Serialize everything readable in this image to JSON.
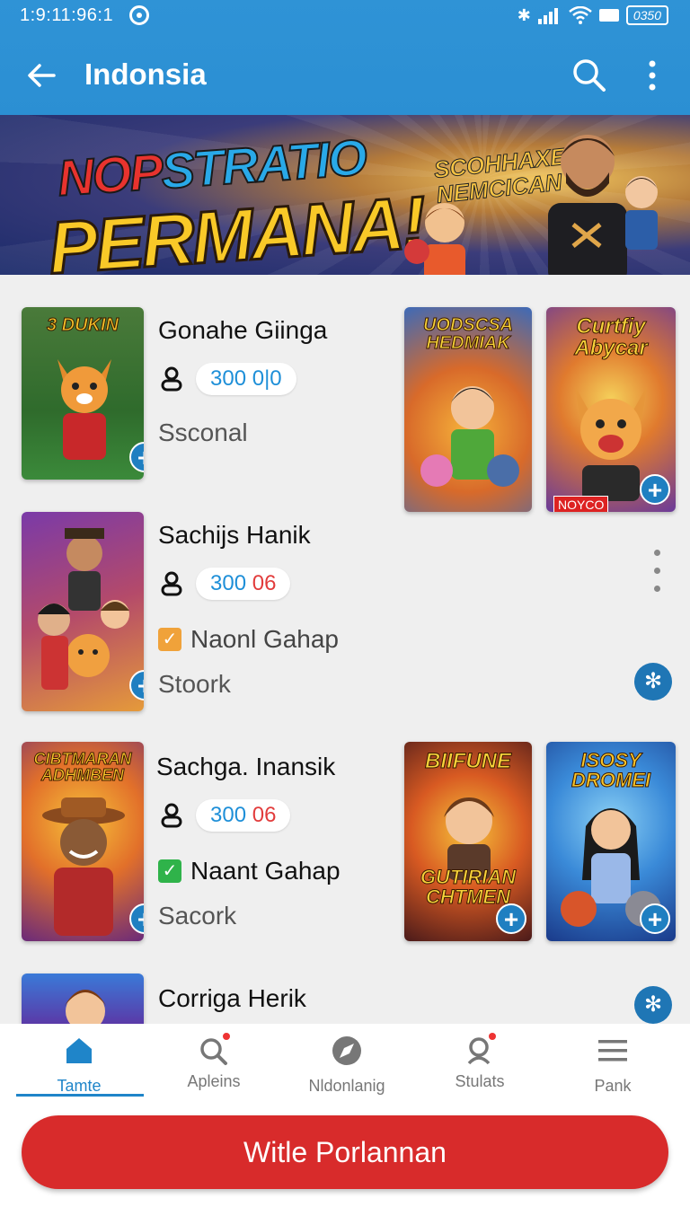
{
  "status_bar": {
    "time": "1:9:11:96:1",
    "battery": "0350"
  },
  "app_bar": {
    "title": "Indonsia"
  },
  "banner": {
    "headline_top": "NOPSTRATIO",
    "headline_top_a": "NOP",
    "headline_top_b": "STRATIO",
    "headline_main": "PERMANA!",
    "side_text_1": "SCOHHAXEHI",
    "side_text_2": "NEMCICAN"
  },
  "items": [
    {
      "title": "Gonahe Giinga",
      "count_a": "300",
      "count_b": "0|0",
      "subtitle": "Ssconal",
      "thumb_title": "3 DUKIN",
      "side_thumbs": [
        {
          "title": "UODSCSA HEDMIAK"
        },
        {
          "title": "Curtfiy Abycar",
          "badge": "NOYCO"
        }
      ]
    },
    {
      "title": "Sachijs Hanik",
      "count_a": "300",
      "count_b": "06",
      "tag": "Naonl Gahap",
      "tag_color": "#f0a23a",
      "subtitle": "Stoork"
    },
    {
      "title": "Sachga. Inansik",
      "count_a": "300",
      "count_b": "06",
      "tag": "Naant Gahap",
      "tag_color": "#2fb34a",
      "subtitle": "Sacork",
      "thumb_title": "CIBTMARAN ADHMBEN",
      "side_thumbs": [
        {
          "title": "BIIFUNE",
          "title2": "GUTIRIAN CHTMEN"
        },
        {
          "title": "ISOSY DROMEI"
        }
      ]
    },
    {
      "title": "Corriga Herik"
    }
  ],
  "bottom_nav": [
    {
      "label": "Tamte",
      "icon": "home-icon",
      "active": true
    },
    {
      "label": "Apleins",
      "icon": "search-icon",
      "active": false
    },
    {
      "label": "Nldonlanig",
      "icon": "compass-icon",
      "active": false
    },
    {
      "label": "Stulats",
      "icon": "person-search-icon",
      "active": false
    },
    {
      "label": "Pank",
      "icon": "menu-icon",
      "active": false
    }
  ],
  "cta": {
    "label": "Witle Porlannan"
  },
  "colors": {
    "primary": "#2f93d6",
    "accent_blue": "#1f85c9",
    "cta_red": "#d82b2b"
  }
}
